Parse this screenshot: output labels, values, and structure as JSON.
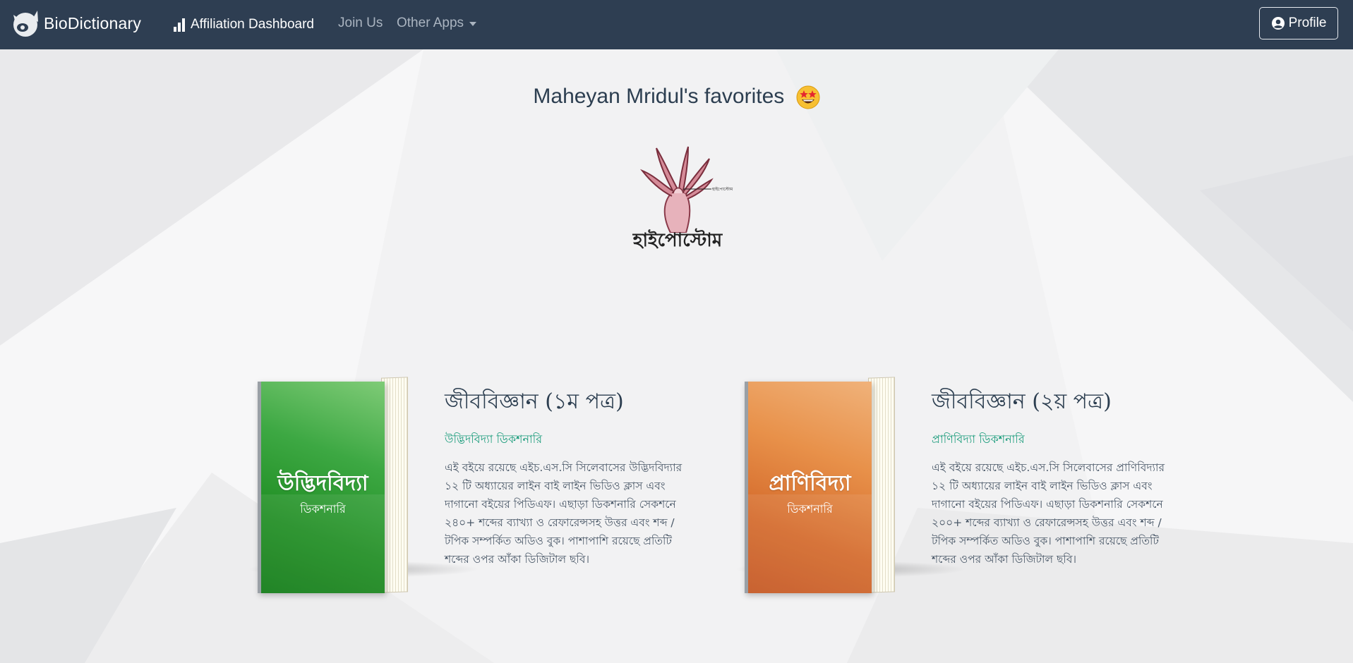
{
  "navbar": {
    "brand": "BioDictionary",
    "affiliation": "Affiliation Dashboard",
    "join": "Join Us",
    "other_apps": "Other Apps",
    "profile": "Profile",
    "bg_color": "#2e3e52"
  },
  "favorites": {
    "heading": "Maheyan Mridul's favorites",
    "emoji_icon": "star-struck-face-icon",
    "word": "হাইপোস্টোম",
    "word_label": "হাইপোস্টোম"
  },
  "books": [
    {
      "cover_title": "উদ্ভিদবিদ্যা",
      "cover_sub": "ডিকশনারি",
      "title": "জীববিজ্ঞান (১ম পত্র)",
      "subtitle": "উদ্ভিদবিদ্যা ডিকশনারি",
      "description": "এই বইয়ে রয়েছে এইচ.এস.সি সিলেবাসের উদ্ভিদবিদ্যার ১২ টি অধ্যায়ের লাইন বাই লাইন ভিডিও ক্লাস এবং দাগানো বইয়ের পিডিএফ। এছাড়া ডিকশনারি সেকশনে ২৪০+ শব্দের ব্যাখ্যা ও রেফারেন্সসহ উত্তর এবং শব্দ / টপিক সম্পর্কিত অডিও বুক। পাশাপাশি রয়েছে প্রতিটি শব্দের ওপর আঁকা ডিজিটাল ছবি।",
      "cover_color": "#2a9a2e"
    },
    {
      "cover_title": "প্রাণিবিদ্যা",
      "cover_sub": "ডিকশনারি",
      "title": "জীববিজ্ঞান (২য় পত্র)",
      "subtitle": "প্রাণিবিদ্যা ডিকশনারি",
      "description": "এই বইয়ে রয়েছে এইচ.এস.সি সিলেবাসের প্রাণিবিদ্যার ১২ টি অধ্যায়ের লাইন বাই লাইন ভিডিও ক্লাস এবং দাগানো বইয়ের পিডিএফ। এছাড়া ডিকশনারি সেকশনে ২০০+ শব্দের ব্যাখ্যা ও রেফারেন্সসহ উত্তর এবং শব্দ / টপিক সম্পর্কিত অডিও বুক। পাশাপাশি রয়েছে প্রতিটি শব্দের ওপর আঁকা ডিজিটাল ছবি।",
      "cover_color": "#d9702f"
    }
  ]
}
